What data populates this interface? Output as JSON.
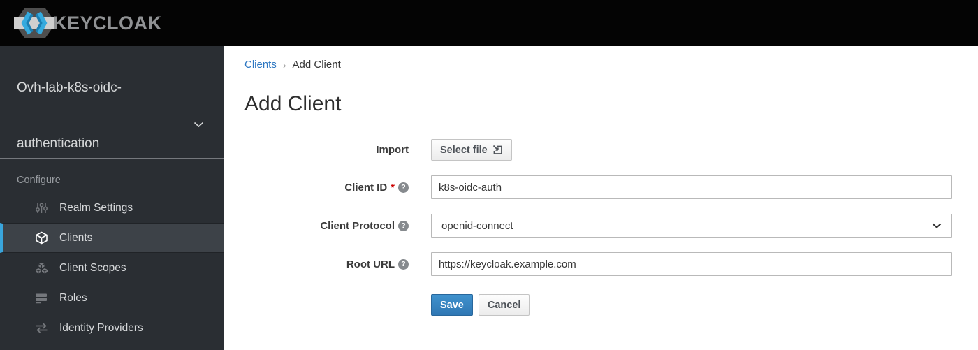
{
  "topbar": {
    "logo_text": "KEYCLOAK"
  },
  "sidebar": {
    "realm_name_line1": "Ovh-lab-k8s-oidc-",
    "realm_name_line2": "authentication",
    "section_label": "Configure",
    "items": [
      {
        "label": "Realm Settings",
        "icon": "sliders-icon",
        "active": false
      },
      {
        "label": "Clients",
        "icon": "cube-icon",
        "active": true
      },
      {
        "label": "Client Scopes",
        "icon": "cubes-icon",
        "active": false
      },
      {
        "label": "Roles",
        "icon": "list-icon",
        "active": false
      },
      {
        "label": "Identity Providers",
        "icon": "exchange-icon",
        "active": false
      }
    ]
  },
  "breadcrumb": {
    "link": "Clients",
    "separator": "›",
    "current": "Add Client"
  },
  "page": {
    "title": "Add Client"
  },
  "form": {
    "import_row": {
      "label": "Import",
      "button_label": "Select file"
    },
    "client_id": {
      "label": "Client ID",
      "required_mark": "*",
      "value": "k8s-oidc-auth"
    },
    "client_protocol": {
      "label": "Client Protocol",
      "value": "openid-connect"
    },
    "root_url": {
      "label": "Root URL",
      "value": "https://keycloak.example.com"
    },
    "save_label": "Save",
    "cancel_label": "Cancel"
  },
  "colors": {
    "accent_blue": "#39a5dc",
    "link_blue": "#2d77c2",
    "primary_button_blue": "#2f77b4",
    "required_red": "#cc0000",
    "sidebar_bg": "#2a2e33",
    "topbar_bg": "#040404"
  }
}
